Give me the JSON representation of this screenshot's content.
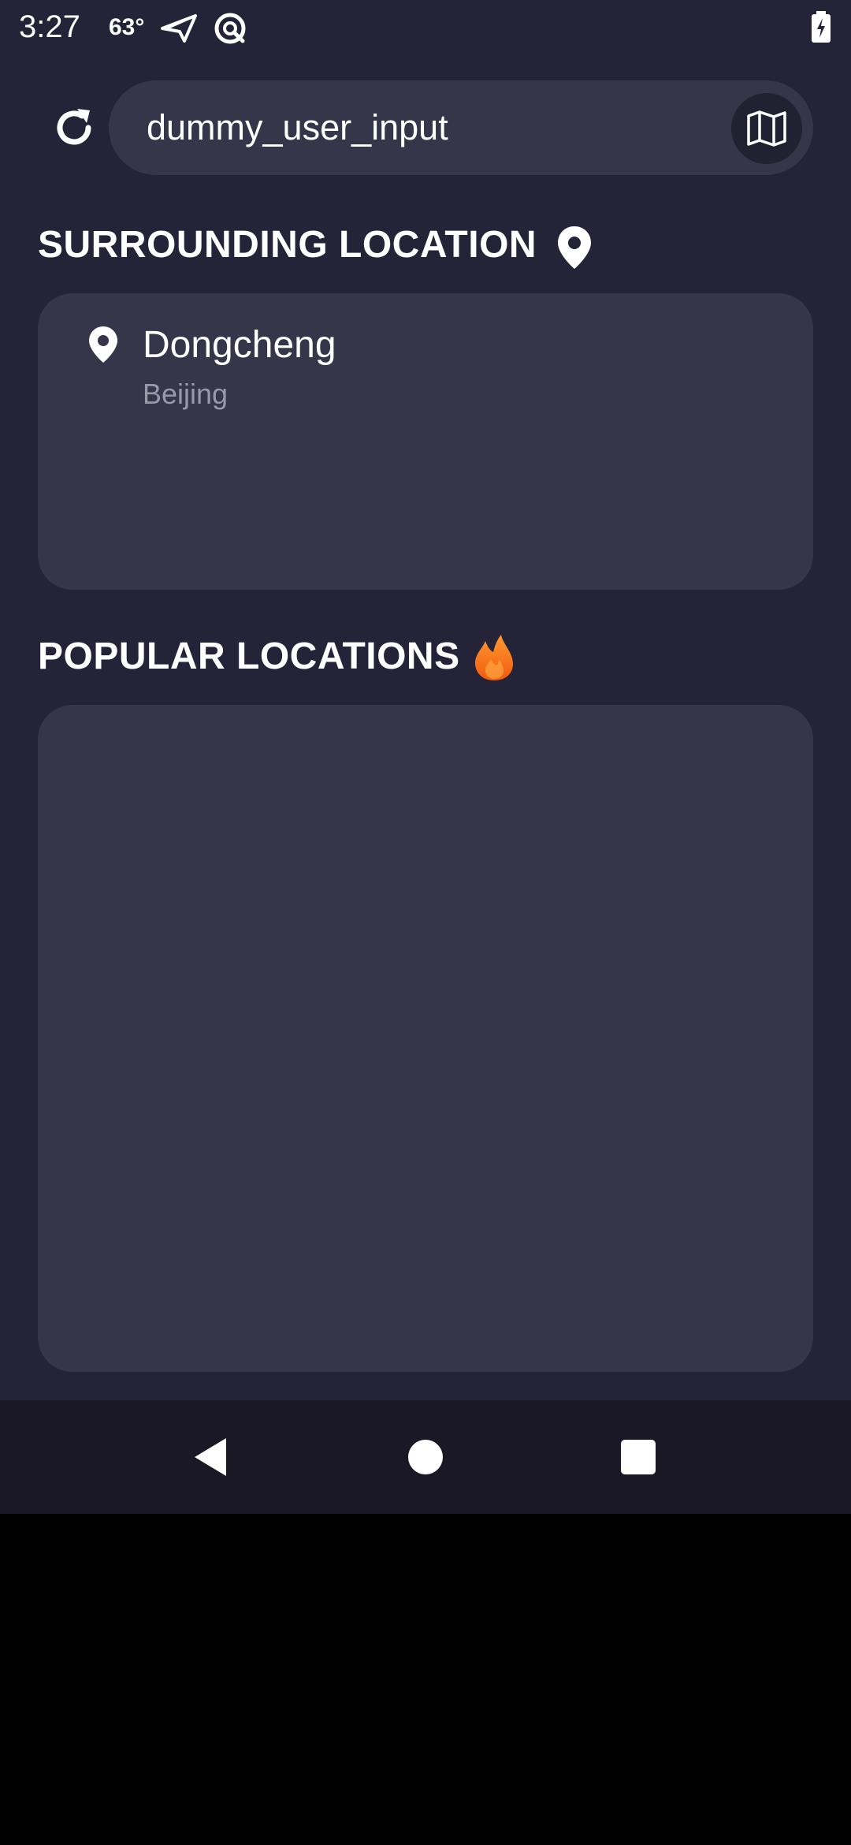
{
  "status_bar": {
    "time": "3:27",
    "temperature": "63°",
    "icons": [
      "send-icon",
      "sync-icon",
      "battery-charging-icon"
    ]
  },
  "search": {
    "value": "dummy_user_input",
    "refresh_icon": "refresh-icon",
    "map_icon": "map-icon"
  },
  "surrounding": {
    "title": "SURROUNDING LOCATION",
    "title_icon": "location-pin-icon",
    "items": [
      {
        "name": "Dongcheng",
        "city": "Beijing",
        "icon": "location-pin-icon"
      }
    ]
  },
  "popular": {
    "title": "POPULAR LOCATIONS",
    "title_icon": "fire-icon",
    "items": []
  },
  "nav_bar": {
    "icons": [
      "back-icon",
      "home-icon",
      "recents-icon"
    ]
  },
  "colors": {
    "background": "#242337",
    "card": "#363549",
    "secondary_text": "#9a99a8",
    "fire_orange": "#f7781d",
    "nav_bar": "#1a1825"
  }
}
